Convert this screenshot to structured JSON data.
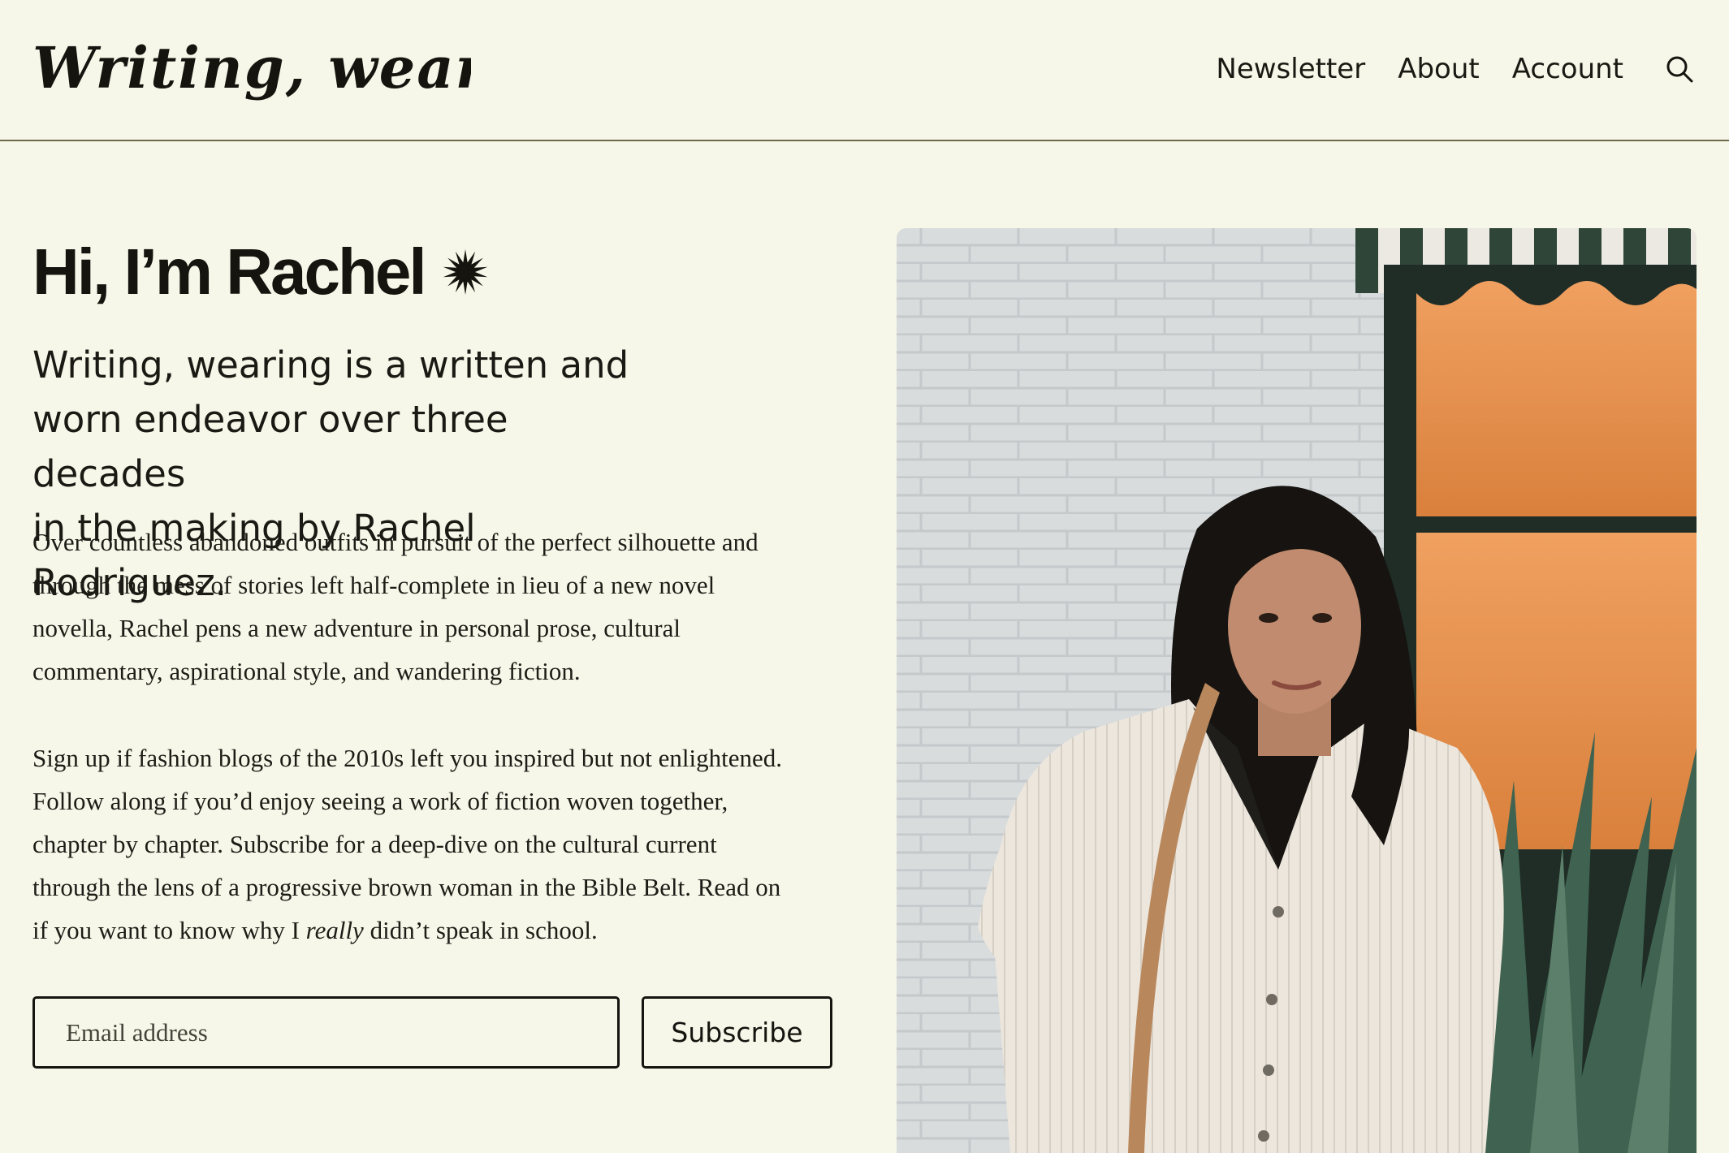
{
  "header": {
    "logo_text": "Writing, wearing",
    "nav": [
      {
        "label": "Newsletter"
      },
      {
        "label": "About"
      },
      {
        "label": "Account"
      }
    ],
    "search_icon": "search-icon"
  },
  "hero": {
    "title": "Hi, I’m Rachel",
    "title_icon": "starburst-icon",
    "lede_lines": [
      "Writing, wearing is a written and",
      "worn endeavor over three decades",
      "in the making by Rachel Rodriguez."
    ],
    "para1_lines": [
      "Over countless abandoned outfits in pursuit of the perfect silhouette and",
      "through the mess of stories left half-complete in lieu of a new novel",
      "novella, Rachel pens a new adventure in personal prose, cultural",
      "commentary, aspirational style, and wandering fiction."
    ],
    "para2_lines": [
      "Sign up if fashion blogs of the 2010s left you inspired but not enlightened.",
      "Follow along if you’d enjoy seeing a work of fiction woven together,",
      "chapter by chapter. Subscribe for a deep-dive on the cultural current",
      "through the lens of a progressive brown woman in the Bible Belt. Read on"
    ],
    "para2_last": {
      "before": "if you want to know why I ",
      "emphasis": "really",
      "after": " didn’t speak in school."
    }
  },
  "signup": {
    "email_placeholder": "Email address",
    "email_value": "",
    "button_label": "Subscribe"
  },
  "colors": {
    "background": "#f7f7e9",
    "text": "#15140f",
    "rule": "#6f6b4a",
    "wall": "#d9dcdd",
    "window_orange": "#e08a45",
    "agave_green": "#3f6350"
  }
}
